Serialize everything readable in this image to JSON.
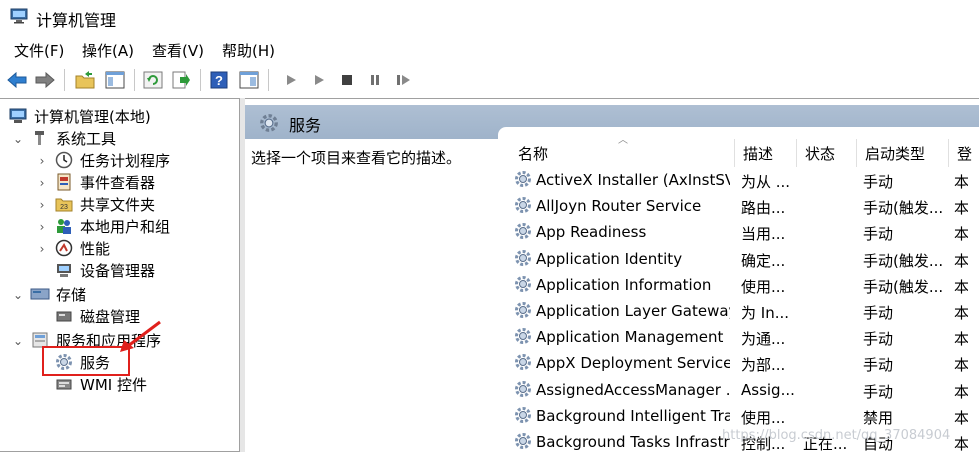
{
  "window": {
    "title": "计算机管理",
    "icon": "computer-management-icon"
  },
  "menu": [
    "文件(F)",
    "操作(A)",
    "查看(V)",
    "帮助(H)"
  ],
  "toolbar": {
    "buttons": [
      "back-icon",
      "forward-icon",
      "up-folder-icon",
      "show-hide-tree-icon",
      "refresh-icon",
      "export-list-icon",
      "help-icon",
      "properties-view-icon",
      "start-service-icon",
      "start-service-alt-icon",
      "stop-service-icon",
      "pause-service-icon",
      "restart-service-icon"
    ]
  },
  "tree": {
    "root": "计算机管理(本地)",
    "system_tools": "系统工具",
    "task_scheduler": "任务计划程序",
    "event_viewer": "事件查看器",
    "shared_folders": "共享文件夹",
    "local_users": "本地用户和组",
    "performance": "性能",
    "device_manager": "设备管理器",
    "storage": "存储",
    "disk_management": "磁盘管理",
    "services_apps": "服务和应用程序",
    "services": "服务",
    "wmi": "WMI 控件"
  },
  "panel": {
    "title": "服务",
    "description_hint": "选择一个项目来查看它的描述。"
  },
  "columns": {
    "name": "名称",
    "description": "描述",
    "status": "状态",
    "startup": "启动类型",
    "logon": "登"
  },
  "services": [
    {
      "name": "ActiveX Installer (AxInstSV)",
      "description": "为从 ...",
      "status": "",
      "startup": "手动",
      "logon": "本"
    },
    {
      "name": "AllJoyn Router Service",
      "description": "路由...",
      "status": "",
      "startup": "手动(触发...",
      "logon": "本"
    },
    {
      "name": "App Readiness",
      "description": "当用...",
      "status": "",
      "startup": "手动",
      "logon": "本"
    },
    {
      "name": "Application Identity",
      "description": "确定...",
      "status": "",
      "startup": "手动(触发...",
      "logon": "本"
    },
    {
      "name": "Application Information",
      "description": "使用...",
      "status": "",
      "startup": "手动(触发...",
      "logon": "本"
    },
    {
      "name": "Application Layer Gateway ...",
      "description": "为 In...",
      "status": "",
      "startup": "手动",
      "logon": "本"
    },
    {
      "name": "Application Management",
      "description": "为通...",
      "status": "",
      "startup": "手动",
      "logon": "本"
    },
    {
      "name": "AppX Deployment Service ...",
      "description": "为部...",
      "status": "",
      "startup": "手动",
      "logon": "本"
    },
    {
      "name": "AssignedAccessManager ...",
      "description": "Assig...",
      "status": "",
      "startup": "手动",
      "logon": "本"
    },
    {
      "name": "Background Intelligent Tra...",
      "description": "使用...",
      "status": "",
      "startup": "禁用",
      "logon": "本"
    },
    {
      "name": "Background Tasks Infrastru...",
      "description": "控制...",
      "status": "正在...",
      "startup": "自动",
      "logon": "本"
    }
  ],
  "watermark": "https://blog.csdn.net/qq_37084904",
  "colors": {
    "header_band": "#9fb3ca",
    "highlight_box": "#e0201c",
    "annotation_arrow": "#e0201c"
  }
}
